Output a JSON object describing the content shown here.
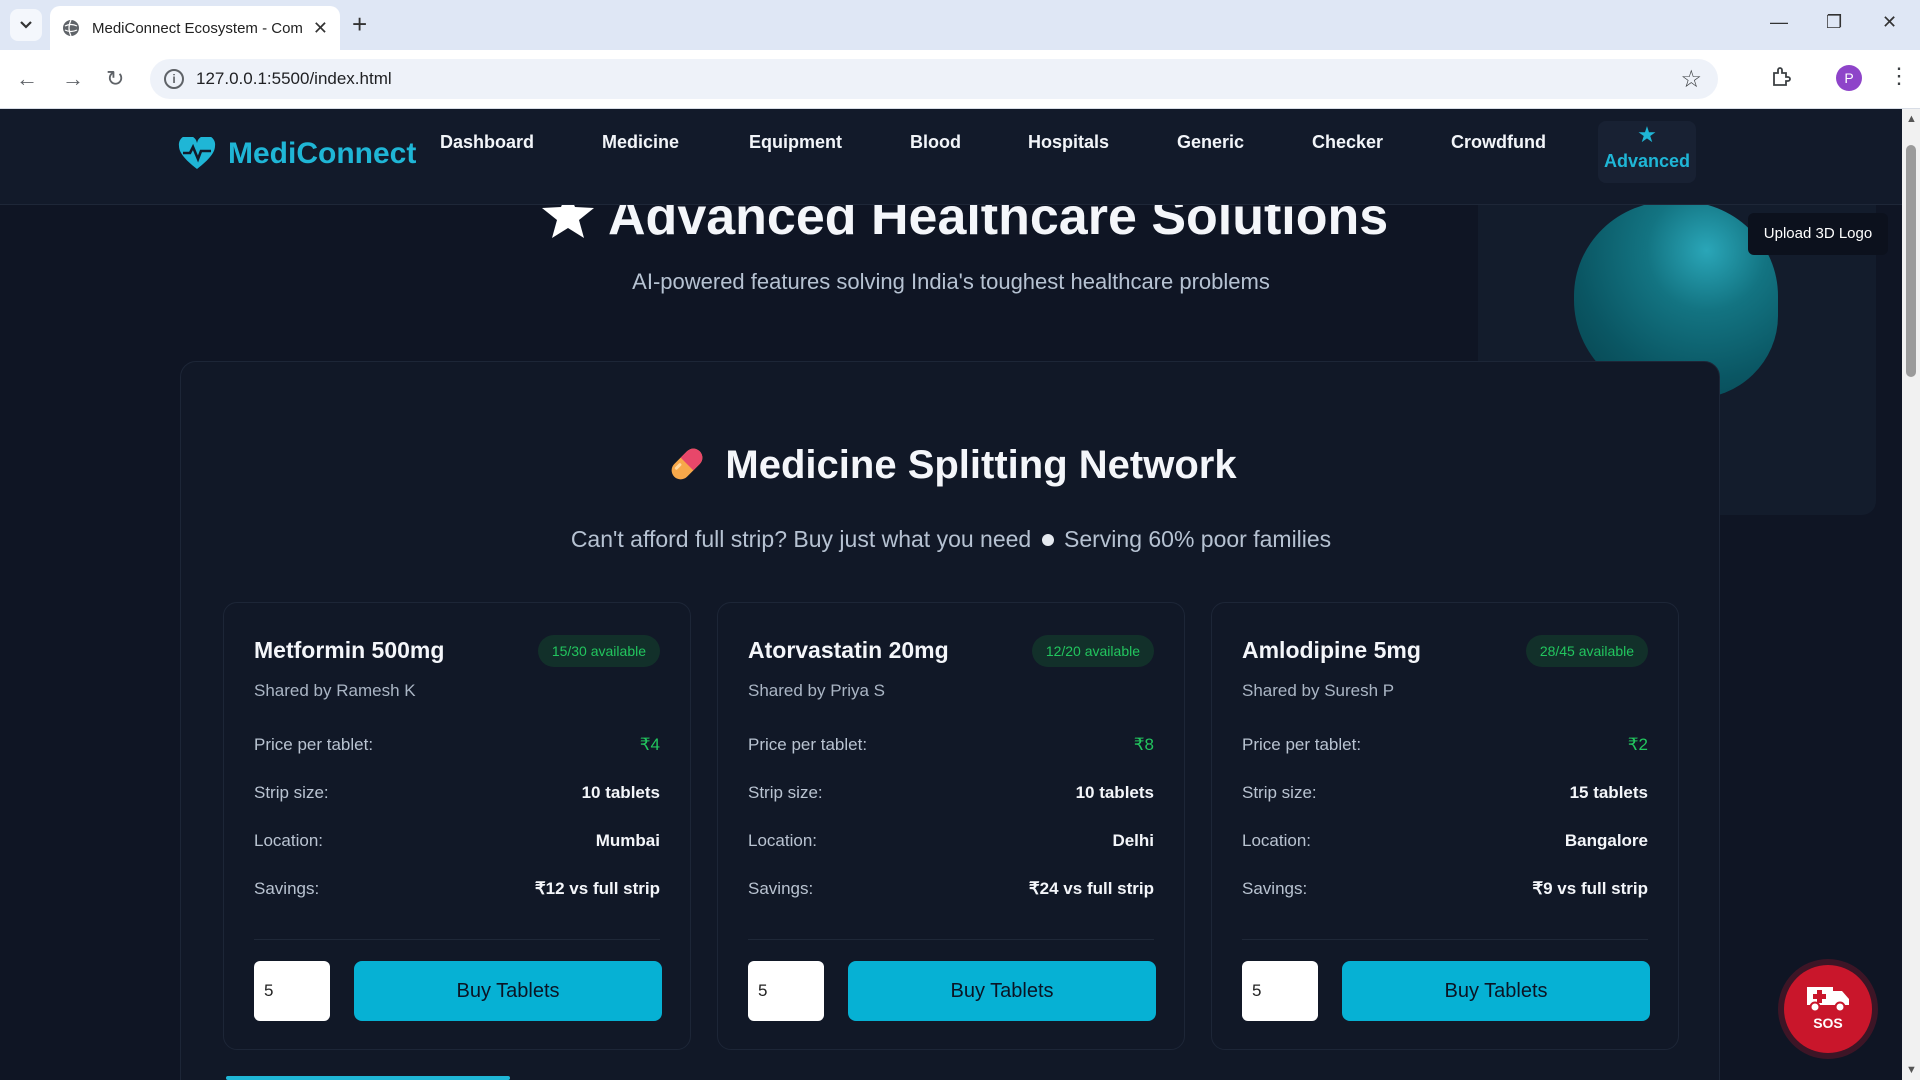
{
  "browser": {
    "tab_title": "MediConnect Ecosystem - Com",
    "url": "127.0.0.1:5500/index.html",
    "profile_initial": "P",
    "new_tab": "+",
    "close": "✕"
  },
  "nav": {
    "logo_text": "MediConnect",
    "items": [
      "Dashboard",
      "Medicine",
      "Equipment",
      "Blood",
      "Hospitals",
      "Generic",
      "Checker",
      "Crowdfund"
    ],
    "advanced_label": "Advanced"
  },
  "hero": {
    "title": "Advanced Healthcare Solutions",
    "subtitle": "AI-powered features solving India's toughest healthcare problems",
    "upload_label": "Upload 3D Logo"
  },
  "splitting": {
    "title": "Medicine Splitting Network",
    "subtitle_a": "Can't afford full strip? Buy just what you need",
    "subtitle_b": "Serving 60% poor families",
    "labels": {
      "price": "Price per tablet:",
      "strip": "Strip size:",
      "location": "Location:",
      "savings": "Savings:"
    },
    "buy_label": "Buy Tablets",
    "cards": [
      {
        "name": "Metformin 500mg",
        "badge": "15/30 available",
        "shared_by": "Shared by Ramesh K",
        "price": "₹4",
        "strip": "10 tablets",
        "location": "Mumbai",
        "savings": "₹12 vs full strip",
        "qty": "5"
      },
      {
        "name": "Atorvastatin 20mg",
        "badge": "12/20 available",
        "shared_by": "Shared by Priya S",
        "price": "₹8",
        "strip": "10 tablets",
        "location": "Delhi",
        "savings": "₹24 vs full strip",
        "qty": "5"
      },
      {
        "name": "Amlodipine 5mg",
        "badge": "28/45 available",
        "shared_by": "Shared by Suresh P",
        "price": "₹2",
        "strip": "15 tablets",
        "location": "Bangalore",
        "savings": "₹9 vs full strip",
        "qty": "5"
      }
    ]
  },
  "sos": {
    "label": "SOS"
  },
  "colors": {
    "accent": "#1fb6d6",
    "button": "#06b1d4",
    "success": "#22c55e",
    "sos": "#c9162b",
    "background": "#0f1524"
  },
  "icons": [
    "globe-icon",
    "heart-pulse-icon",
    "star-icon",
    "pill-icon",
    "ambulance-icon",
    "extensions-icon",
    "bookmark-star-icon",
    "info-icon"
  ]
}
